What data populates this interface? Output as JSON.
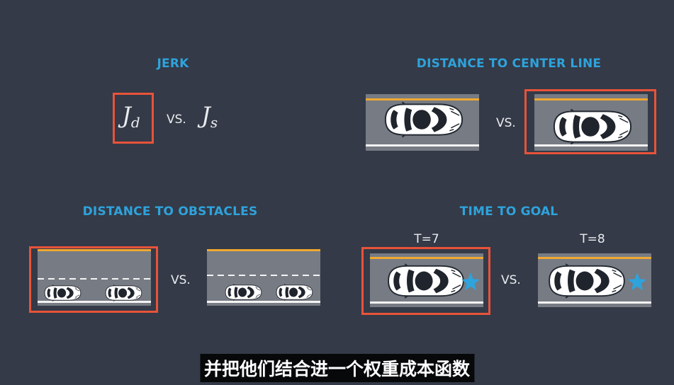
{
  "panels": {
    "jerk": {
      "title": "JERK",
      "left_symbol": "J",
      "left_subscript": "d",
      "vs": "VS.",
      "right_symbol": "J",
      "right_subscript": "s"
    },
    "center_line": {
      "title": "DISTANCE TO CENTER LINE",
      "vs": "VS."
    },
    "obstacles": {
      "title": "DISTANCE TO OBSTACLES",
      "vs": "VS."
    },
    "goal": {
      "title": "TIME TO GOAL",
      "vs": "VS.",
      "left_label": "T=7",
      "right_label": "T=8"
    }
  },
  "subtitle": "并把他们结合进一个权重成本函数",
  "colors": {
    "background": "#343a47",
    "title": "#2ea3dc",
    "highlight": "#e8533a",
    "road": "#777b84",
    "center_line": "#f0a830",
    "edge_line": "#f4f4f4",
    "star": "#2ea3dc"
  },
  "icons": [
    "car-icon",
    "star-icon"
  ]
}
